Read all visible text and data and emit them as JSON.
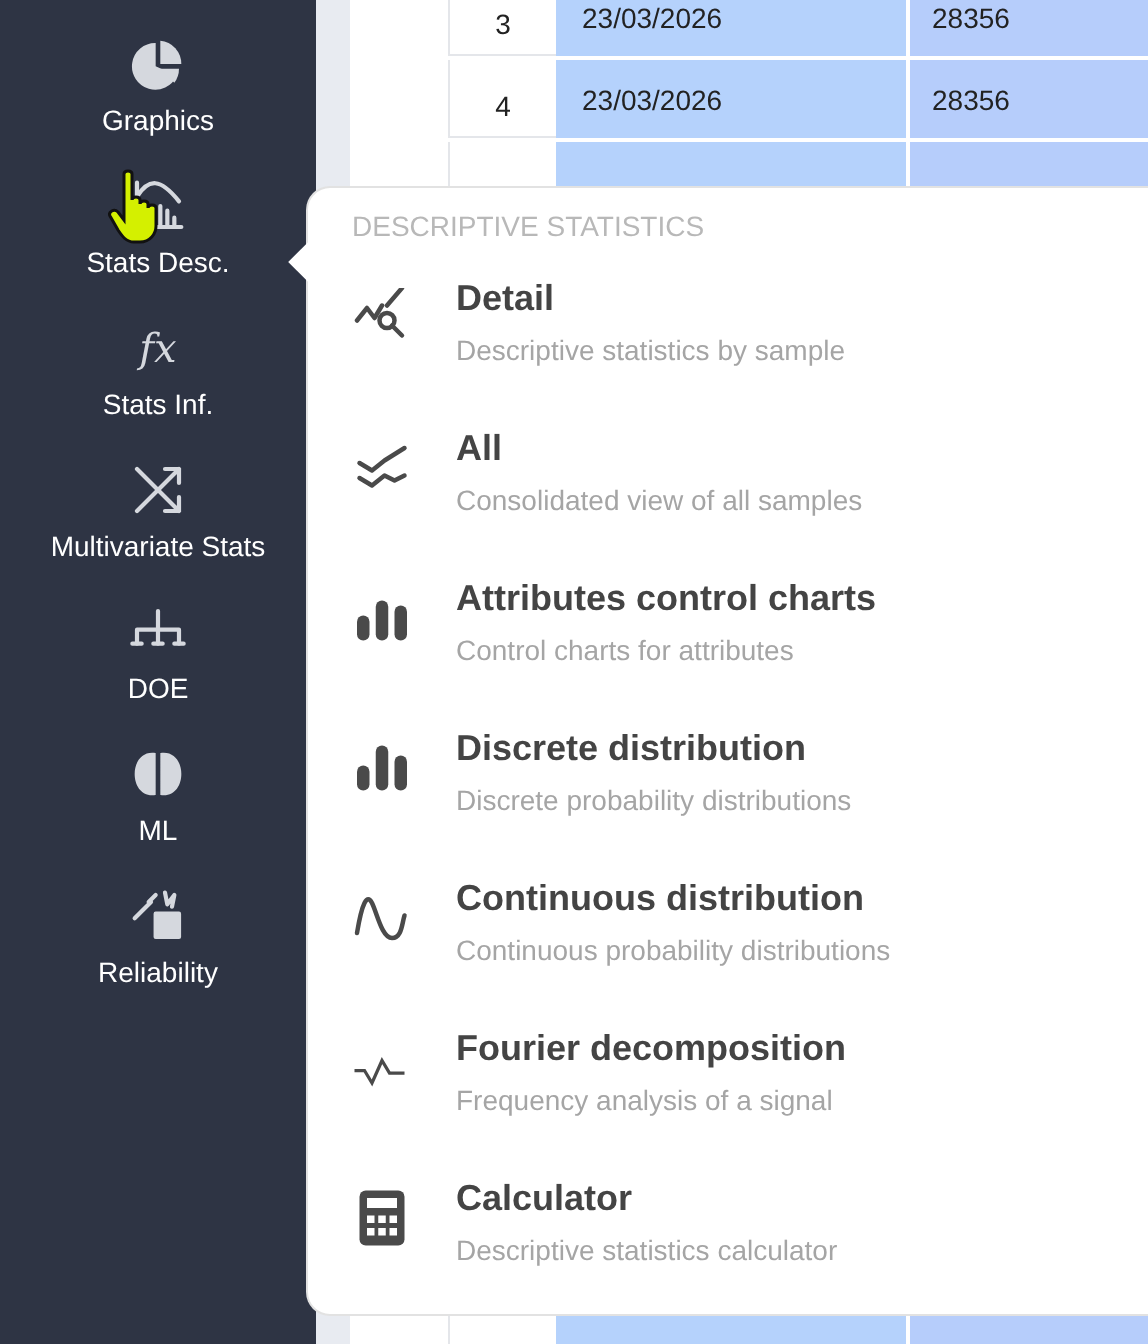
{
  "sidebar": {
    "items": [
      {
        "label": "Graphics"
      },
      {
        "label": "Stats Desc."
      },
      {
        "label": "Stats Inf.",
        "icon": "fx"
      },
      {
        "label": "Multivariate Stats"
      },
      {
        "label": "DOE"
      },
      {
        "label": "ML"
      },
      {
        "label": "Reliability"
      }
    ]
  },
  "table": {
    "rows": [
      {
        "cells": [
          "3",
          "23/03/2026",
          "28356"
        ]
      },
      {
        "cells": [
          "4",
          "23/03/2026",
          "28356"
        ]
      }
    ]
  },
  "menu": {
    "title": "DESCRIPTIVE STATISTICS",
    "items": [
      {
        "title": "Detail",
        "description": "Descriptive statistics by sample"
      },
      {
        "title": "All",
        "description": "Consolidated view of all samples"
      },
      {
        "title": "Attributes control charts",
        "description": "Control charts for attributes"
      },
      {
        "title": "Discrete distribution",
        "description": "Discrete probability distributions"
      },
      {
        "title": "Continuous distribution",
        "description": "Continuous probability distributions"
      },
      {
        "title": "Fourier decomposition",
        "description": "Frequency analysis of a signal"
      },
      {
        "title": "Calculator",
        "description": "Descriptive statistics calculator"
      }
    ]
  }
}
